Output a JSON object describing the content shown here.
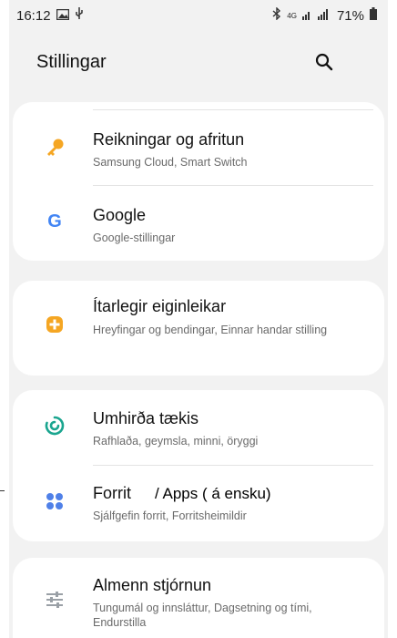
{
  "status_bar": {
    "time": "16:12",
    "network_label": "4G",
    "battery_percent": "71%"
  },
  "header": {
    "title": "Stillingar"
  },
  "settings": {
    "accounts": {
      "title": "Reikningar og afritun",
      "subtitle": "Samsung Cloud, Smart Switch"
    },
    "google": {
      "title": "Google",
      "subtitle": "Google-stillingar"
    },
    "advanced": {
      "title": "Ítarlegir eiginleikar",
      "subtitle": "Hreyfingar og bendingar, Einnar handar stilling"
    },
    "device_care": {
      "title": "Umhirða tækis",
      "subtitle": "Rafhlaða, geymsla, minni, öryggi"
    },
    "apps": {
      "title": "Forrit",
      "subtitle": "Sjálfgefin forrit, Forritsheimildir",
      "annotation": "/ Apps ( á ensku)"
    },
    "general": {
      "title": "Almenn stjórnun",
      "subtitle": "Tungumál og innsláttur, Dagsetning og tími, Endurstilla"
    }
  },
  "colors": {
    "key_icon": "#f5a623",
    "google_blue": "#4285f4",
    "advanced_icon": "#f5a623",
    "device_care_icon": "#1aa58f",
    "apps_icon": "#4f80e8",
    "general_icon": "#9aa0a6"
  }
}
